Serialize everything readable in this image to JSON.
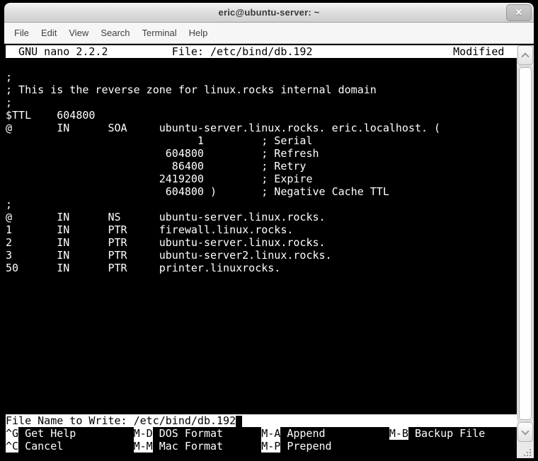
{
  "window": {
    "title": "eric@ubuntu-server: ~",
    "close_glyph": "✕"
  },
  "menu": {
    "items": [
      "File",
      "Edit",
      "View",
      "Search",
      "Terminal",
      "Help"
    ]
  },
  "nano": {
    "header": {
      "version": "GNU nano 2.2.2",
      "file": "File: /etc/bind/db.192",
      "modified": "Modified"
    },
    "buffer_rows": 28,
    "buffer_lines": [
      "",
      ";",
      "; This is the reverse zone for linux.rocks internal domain",
      ";",
      "$TTL    604800",
      "@       IN      SOA     ubuntu-server.linux.rocks. eric.localhost. (",
      "                              1         ; Serial",
      "                         604800         ; Refresh",
      "                          86400         ; Retry",
      "                        2419200         ; Expire",
      "                         604800 )       ; Negative Cache TTL",
      ";",
      "@       IN      NS      ubuntu-server.linux.rocks.",
      "1       IN      PTR     firewall.linux.rocks.",
      "2       IN      PTR     ubuntu-server.linux.rocks.",
      "3       IN      PTR     ubuntu-server2.linux.rocks.",
      "50      IN      PTR     printer.linuxrocks."
    ],
    "prompt": "File Name to Write: /etc/bind/db.192",
    "shortcuts_row1": [
      {
        "key": "^G",
        "label": "Get Help"
      },
      {
        "key": "M-D",
        "label": "DOS Format"
      },
      {
        "key": "M-A",
        "label": "Append"
      },
      {
        "key": "M-B",
        "label": "Backup File"
      }
    ],
    "shortcuts_row2": [
      {
        "key": "^C",
        "label": "Cancel"
      },
      {
        "key": "M-M",
        "label": "Mac Format"
      },
      {
        "key": "M-P",
        "label": "Prepend"
      }
    ]
  },
  "colors": {
    "terminal_bg": "#000000",
    "terminal_fg": "#ffffff",
    "inverted_bar_bg": "#ffffff",
    "inverted_bar_fg": "#000000",
    "titlebar_bg": "#e3e3e3",
    "menubar_bg": "#f6f6f6"
  }
}
